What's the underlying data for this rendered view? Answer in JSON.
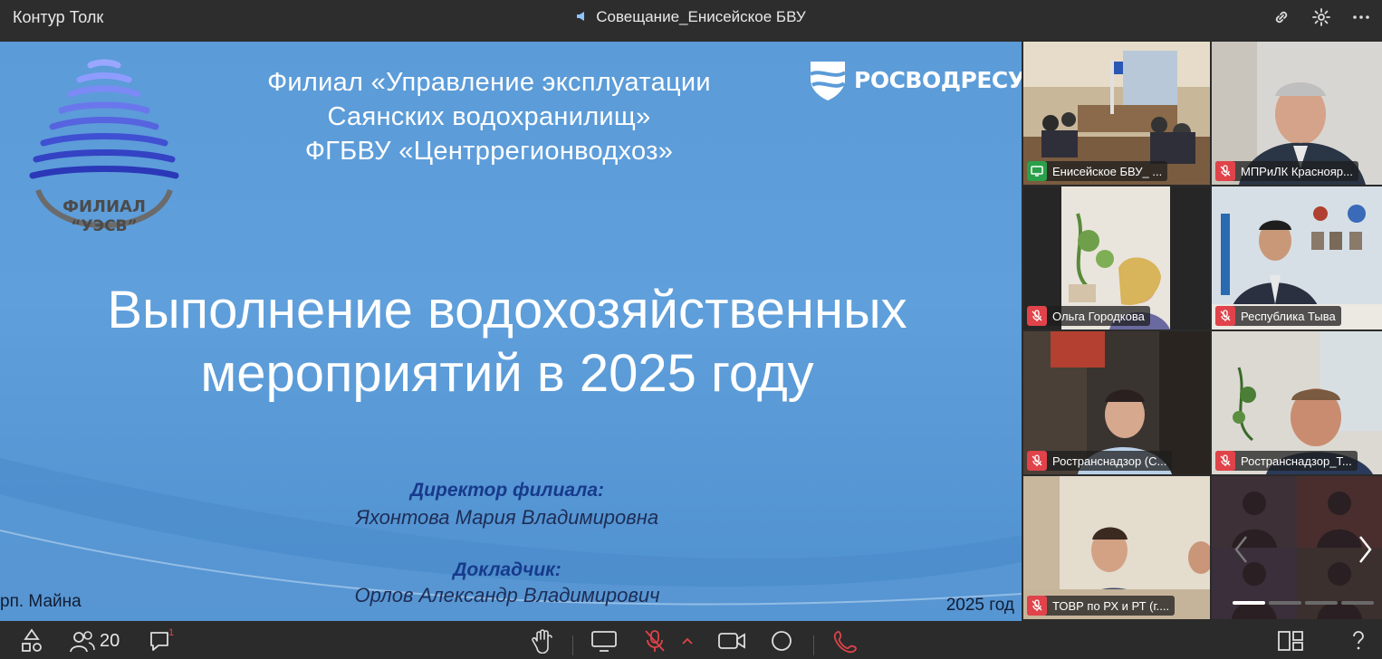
{
  "app": {
    "title": "Контур Толк"
  },
  "meeting": {
    "title": "Совещание_Енисейское БВУ"
  },
  "slide": {
    "org_lines": [
      "Филиал «Управление эксплуатации",
      "Саянских водохранилищ»",
      "ФГБВУ «Центррегионводхоз»"
    ],
    "brand": "РОСВОДРЕСУРСЫ",
    "logo_text_1": "ФИЛИАЛ",
    "logo_text_2": "“УЭСВ”",
    "title_line1": "Выполнение водохозяйственных",
    "title_line2": "мероприятий в 2025 году",
    "role1": "Директор филиала:",
    "name1": "Яхонтова Мария Владимировна",
    "role2": "Докладчик:",
    "name2": "Орлов Александр Владимирович",
    "place": "рп. Майна",
    "year": "2025 год"
  },
  "participants": [
    {
      "name": "Енисейское БВУ_ ...",
      "status": "screen-share-icon",
      "active": true
    },
    {
      "name": "МПРиЛК Краснояр...",
      "status": "mic-off-icon"
    },
    {
      "name": "Ольга Городкова",
      "status": "mic-off-icon"
    },
    {
      "name": "Республика Тыва",
      "status": "mic-off-icon"
    },
    {
      "name": "Ространснадзор (С...",
      "status": "mic-off-icon"
    },
    {
      "name": "Ространснадзор_Т...",
      "status": "mic-off-icon"
    },
    {
      "name": "ТОВР по РХ и РТ (г....",
      "status": "mic-off-icon"
    }
  ],
  "toolbar": {
    "participants_count": "20",
    "chat_badge": "1"
  },
  "colors": {
    "accent": "#1f8bff",
    "mic_off": "#e0434a",
    "screen_share": "#2aa04a",
    "end_call": "#e0434a"
  }
}
